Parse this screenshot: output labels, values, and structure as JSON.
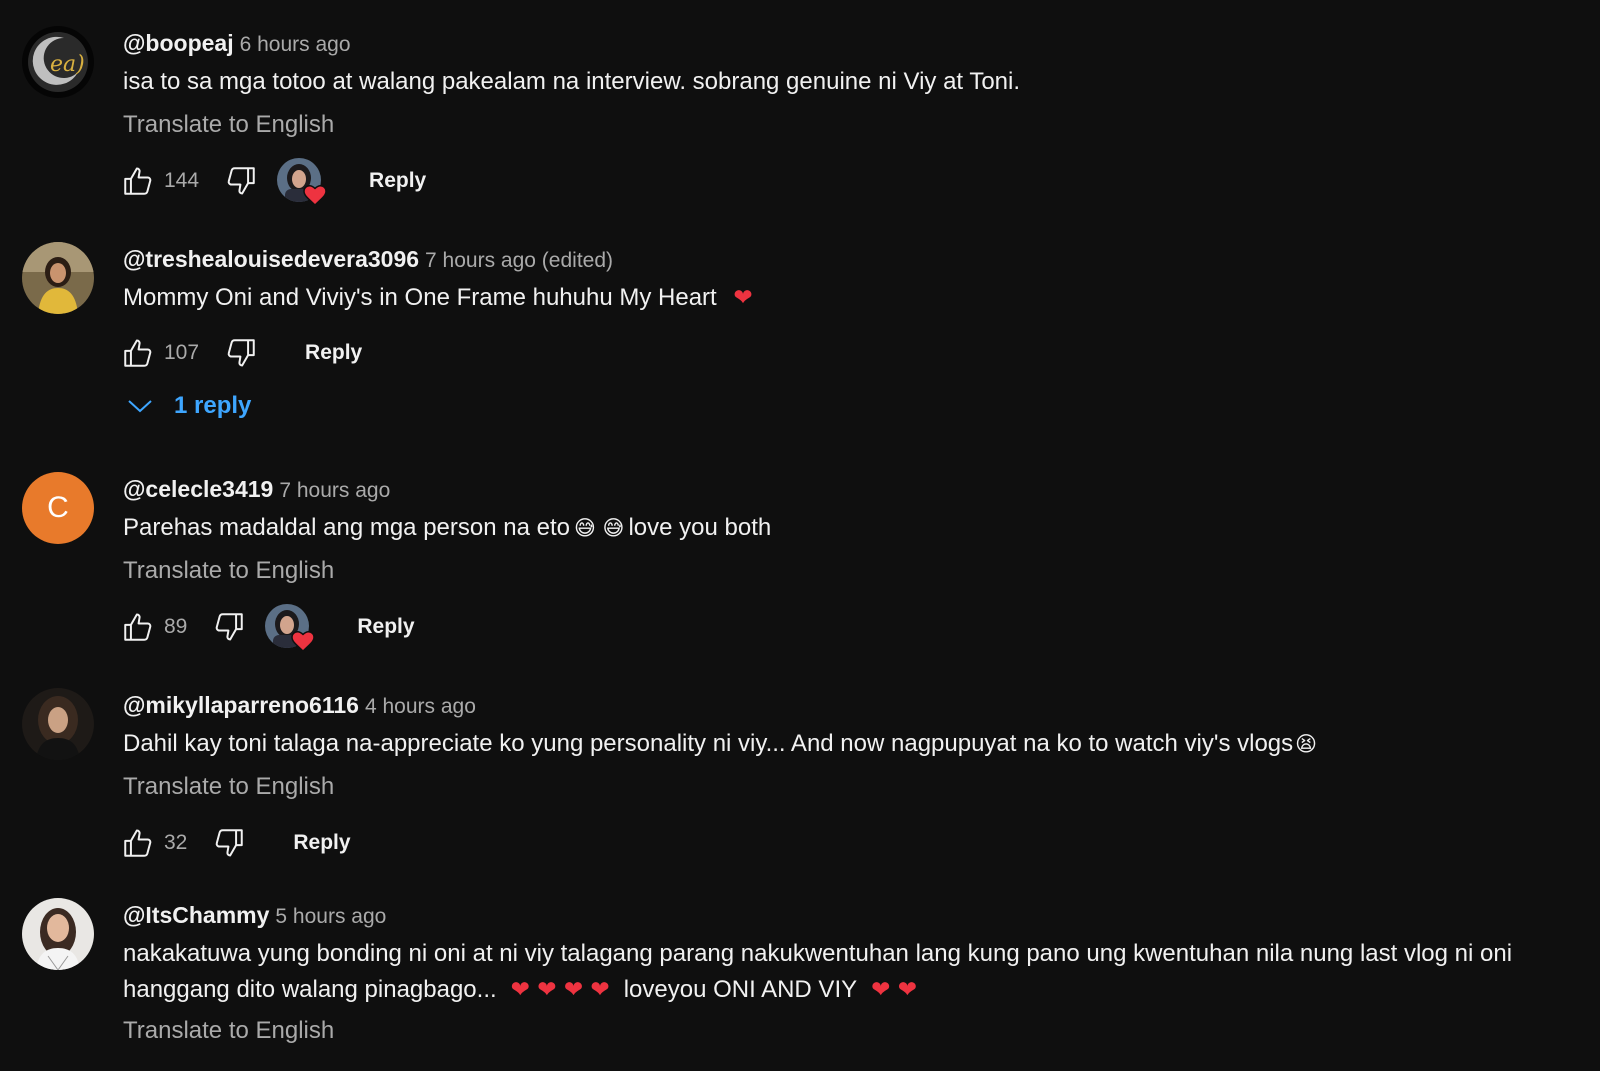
{
  "comments": [
    {
      "author": "@boopeaj",
      "time": "6 hours ago",
      "text": "isa to sa mga totoo at walang pakealam na interview. sobrang genuine ni Viy at Toni.",
      "translate_label": "Translate to English",
      "likes": "144",
      "reply_label": "Reply"
    },
    {
      "author": "@treshealouisedevera3096",
      "time": "7 hours ago (edited)",
      "text": "Mommy Oni and Viviy's in One Frame huhuhu My Heart ",
      "text_emoji": "❤",
      "likes": "107",
      "reply_label": "Reply",
      "replies_label": "1 reply"
    },
    {
      "author": "@celecle3419",
      "avatar_letter": "C",
      "time": "7 hours ago",
      "text_a": "Parehas madaldal ang  mga person na eto",
      "text_emoji": "😅 😅",
      "text_b": "love you both",
      "translate_label": "Translate to English",
      "likes": "89",
      "reply_label": "Reply"
    },
    {
      "author": "@mikyllaparreno6116",
      "time": "4 hours ago",
      "text": "Dahil kay toni talaga na-appreciate ko yung personality ni viy... And now nagpupuyat na ko to watch viy's vlogs",
      "text_emoji": "😫",
      "translate_label": "Translate to English",
      "likes": "32",
      "reply_label": "Reply"
    },
    {
      "author": "@ItsChammy",
      "time": "5 hours ago",
      "line1": "nakakatuwa yung bonding ni oni at ni viy talagang parang nakukwentuhan lang kung pano ung kwentuhan nila nung last vlog ni oni",
      "line2_a": "hanggang dito walang pinagbago...",
      "line2_hearts_a": "❤ ❤ ❤ ❤",
      "line2_b": "loveyou ONI AND VIY",
      "line2_hearts_b": "❤ ❤",
      "translate_label": "Translate to English"
    }
  ],
  "colors": {
    "background": "#0f0f0f",
    "link_blue": "#3ea6ff",
    "heart_red": "#ee3340",
    "letter_avatar": "#e87a2b"
  }
}
